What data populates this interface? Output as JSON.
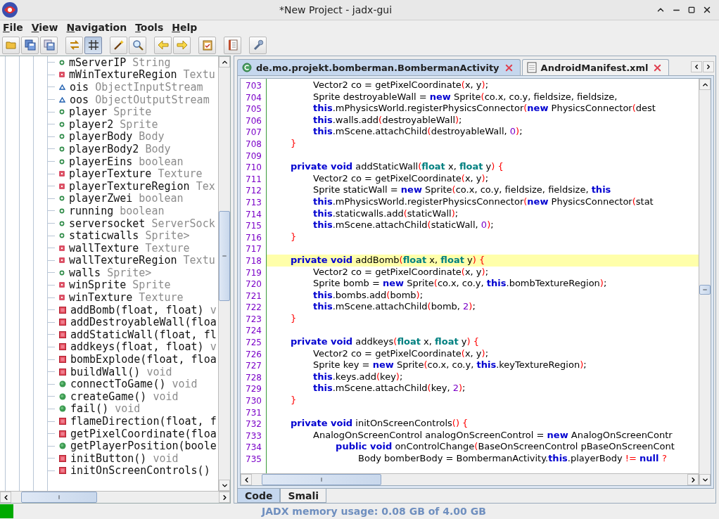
{
  "window": {
    "title": "*New Project - jadx-gui"
  },
  "menu": [
    {
      "label": "File"
    },
    {
      "label": "View"
    },
    {
      "label": "Navigation"
    },
    {
      "label": "Tools"
    },
    {
      "label": "Help"
    }
  ],
  "toolbar": [
    {
      "kind": "open",
      "pressed": false
    },
    {
      "kind": "save-all",
      "pressed": false
    },
    {
      "kind": "export",
      "pressed": false
    },
    {
      "kind": "sync",
      "pressed": false
    },
    {
      "kind": "flatten",
      "pressed": true
    },
    {
      "kind": "wand",
      "pressed": false
    },
    {
      "kind": "search",
      "pressed": false
    },
    {
      "kind": "back",
      "pressed": false
    },
    {
      "kind": "forward",
      "pressed": false
    },
    {
      "kind": "clipboard",
      "pressed": false
    },
    {
      "kind": "log",
      "pressed": false
    },
    {
      "kind": "settings",
      "pressed": false
    }
  ],
  "tree": {
    "items": [
      {
        "kind": "field-public",
        "name": "mServerIP",
        "type": "String"
      },
      {
        "kind": "field-private",
        "name": "mWinTextureRegion",
        "type": "Textu"
      },
      {
        "kind": "field-package",
        "name": "ois",
        "type": "ObjectInputStream"
      },
      {
        "kind": "field-package",
        "name": "oos",
        "type": "ObjectOutputStream"
      },
      {
        "kind": "field-public",
        "name": "player",
        "type": "Sprite"
      },
      {
        "kind": "field-public",
        "name": "player2",
        "type": "Sprite"
      },
      {
        "kind": "field-public",
        "name": "playerBody",
        "type": "Body"
      },
      {
        "kind": "field-public",
        "name": "playerBody2",
        "type": "Body"
      },
      {
        "kind": "field-public",
        "name": "playerEins",
        "type": "boolean"
      },
      {
        "kind": "field-private",
        "name": "playerTexture",
        "type": "Texture"
      },
      {
        "kind": "field-private",
        "name": "playerTextureRegion",
        "type": "Tex"
      },
      {
        "kind": "field-public",
        "name": "playerZwei",
        "type": "boolean"
      },
      {
        "kind": "field-public",
        "name": "running",
        "type": "boolean"
      },
      {
        "kind": "field-public",
        "name": "serversocket",
        "type": "ServerSock"
      },
      {
        "kind": "field-public",
        "name": "staticwalls",
        "type": "Sprite>"
      },
      {
        "kind": "field-private",
        "name": "wallTexture",
        "type": "Texture"
      },
      {
        "kind": "field-private",
        "name": "wallTextureRegion",
        "type": "Textu"
      },
      {
        "kind": "field-public",
        "name": "walls",
        "type": "Sprite>"
      },
      {
        "kind": "field-private",
        "name": "winSprite",
        "type": "Sprite"
      },
      {
        "kind": "field-private",
        "name": "winTexture",
        "type": "Texture"
      },
      {
        "kind": "method-private",
        "name": "addBomb(float, float)",
        "type": "v"
      },
      {
        "kind": "method-private",
        "name": "addDestroyableWall(floa"
      },
      {
        "kind": "method-private",
        "name": "addStaticWall(float, fl"
      },
      {
        "kind": "method-private",
        "name": "addkeys(float, float)",
        "type": "v"
      },
      {
        "kind": "method-private",
        "name": "bombExplode(float, floa"
      },
      {
        "kind": "method-private",
        "name": "buildWall()",
        "type": "void"
      },
      {
        "kind": "method-public",
        "name": "connectToGame()",
        "type": "void"
      },
      {
        "kind": "method-public",
        "name": "createGame()",
        "type": "void"
      },
      {
        "kind": "method-public",
        "name": "fail()",
        "type": "void"
      },
      {
        "kind": "method-private",
        "name": "flameDirection(float, f"
      },
      {
        "kind": "method-private",
        "name": "getPixelCoordinate(floa"
      },
      {
        "kind": "method-public",
        "name": "getPlayerPosition(boole"
      },
      {
        "kind": "method-private",
        "name": "initButton()",
        "type": "void"
      },
      {
        "kind": "method-private",
        "name": "initOnScreenControls()"
      }
    ]
  },
  "editor_tabs": [
    {
      "kind": "class",
      "label": "de.mo.projekt.bomberman.BombermanActivity",
      "selected": true
    },
    {
      "kind": "xml",
      "label": "AndroidManifest.xml",
      "selected": false
    }
  ],
  "code": {
    "lines": [
      {
        "number": "703",
        "highlighted": false,
        "code": [
          {
            "kind": "plain",
            "text": "        Vector2 co = getPixelCoordinate"
          },
          {
            "kind": "bracket",
            "text": "("
          },
          {
            "kind": "plain",
            "text": "x, y"
          },
          {
            "kind": "bracket",
            "text": ")"
          },
          {
            "kind": "plain",
            "text": ";"
          }
        ]
      },
      {
        "number": "704",
        "highlighted": false,
        "code": [
          {
            "kind": "plain",
            "text": "        Sprite destroyableWall = "
          },
          {
            "kind": "keyword",
            "text": "new"
          },
          {
            "kind": "plain",
            "text": " Sprite"
          },
          {
            "kind": "bracket",
            "text": "("
          },
          {
            "kind": "plain",
            "text": "co.x, co.y, fieldsize, fieldsize,"
          }
        ]
      },
      {
        "number": "705",
        "highlighted": false,
        "code": [
          {
            "kind": "keyword",
            "text": "        this"
          },
          {
            "kind": "plain",
            "text": ".mPhysicsWorld.registerPhysicsConnector"
          },
          {
            "kind": "bracket",
            "text": "("
          },
          {
            "kind": "keyword",
            "text": "new"
          },
          {
            "kind": "plain",
            "text": " PhysicsConnector"
          },
          {
            "kind": "bracket",
            "text": "("
          },
          {
            "kind": "plain",
            "text": "dest"
          }
        ]
      },
      {
        "number": "706",
        "highlighted": false,
        "code": [
          {
            "kind": "keyword",
            "text": "        this"
          },
          {
            "kind": "plain",
            "text": ".walls.add"
          },
          {
            "kind": "bracket",
            "text": "("
          },
          {
            "kind": "plain",
            "text": "destroyableWall"
          },
          {
            "kind": "bracket",
            "text": ")"
          },
          {
            "kind": "plain",
            "text": ";"
          }
        ]
      },
      {
        "number": "707",
        "highlighted": false,
        "code": [
          {
            "kind": "keyword",
            "text": "        this"
          },
          {
            "kind": "plain",
            "text": ".mScene.attachChild"
          },
          {
            "kind": "bracket",
            "text": "("
          },
          {
            "kind": "plain",
            "text": "destroyableWall, "
          },
          {
            "kind": "number",
            "text": "0"
          },
          {
            "kind": "bracket",
            "text": ")"
          },
          {
            "kind": "plain",
            "text": ";"
          }
        ]
      },
      {
        "number": "708",
        "highlighted": false,
        "code": [
          {
            "kind": "bracket",
            "text": "    }"
          }
        ]
      },
      {
        "number": "709",
        "highlighted": false
      },
      {
        "number": "710",
        "highlighted": false,
        "code": [
          {
            "kind": "keyword",
            "text": "    private void"
          },
          {
            "kind": "plain",
            "text": " addStaticWall"
          },
          {
            "kind": "bracket",
            "text": "("
          },
          {
            "kind": "type",
            "text": "float"
          },
          {
            "kind": "plain",
            "text": " x, "
          },
          {
            "kind": "type",
            "text": "float"
          },
          {
            "kind": "plain",
            "text": " y"
          },
          {
            "kind": "bracket",
            "text": ") {"
          }
        ]
      },
      {
        "number": "711",
        "highlighted": false,
        "code": [
          {
            "kind": "plain",
            "text": "        Vector2 co = getPixelCoordinate"
          },
          {
            "kind": "bracket",
            "text": "("
          },
          {
            "kind": "plain",
            "text": "x, y"
          },
          {
            "kind": "bracket",
            "text": ")"
          },
          {
            "kind": "plain",
            "text": ";"
          }
        ]
      },
      {
        "number": "712",
        "highlighted": false,
        "code": [
          {
            "kind": "plain",
            "text": "        Sprite staticWall = "
          },
          {
            "kind": "keyword",
            "text": "new"
          },
          {
            "kind": "plain",
            "text": " Sprite"
          },
          {
            "kind": "bracket",
            "text": "("
          },
          {
            "kind": "plain",
            "text": "co.x, co.y, fieldsize, fieldsize, "
          },
          {
            "kind": "keyword",
            "text": "this"
          }
        ]
      },
      {
        "number": "713",
        "highlighted": false,
        "code": [
          {
            "kind": "keyword",
            "text": "        this"
          },
          {
            "kind": "plain",
            "text": ".mPhysicsWorld.registerPhysicsConnector"
          },
          {
            "kind": "bracket",
            "text": "("
          },
          {
            "kind": "keyword",
            "text": "new"
          },
          {
            "kind": "plain",
            "text": " PhysicsConnector"
          },
          {
            "kind": "bracket",
            "text": "("
          },
          {
            "kind": "plain",
            "text": "stat"
          }
        ]
      },
      {
        "number": "714",
        "highlighted": false,
        "code": [
          {
            "kind": "keyword",
            "text": "        this"
          },
          {
            "kind": "plain",
            "text": ".staticwalls.add"
          },
          {
            "kind": "bracket",
            "text": "("
          },
          {
            "kind": "plain",
            "text": "staticWall"
          },
          {
            "kind": "bracket",
            "text": ")"
          },
          {
            "kind": "plain",
            "text": ";"
          }
        ]
      },
      {
        "number": "715",
        "highlighted": false,
        "code": [
          {
            "kind": "keyword",
            "text": "        this"
          },
          {
            "kind": "plain",
            "text": ".mScene.attachChild"
          },
          {
            "kind": "bracket",
            "text": "("
          },
          {
            "kind": "plain",
            "text": "staticWall, "
          },
          {
            "kind": "number",
            "text": "0"
          },
          {
            "kind": "bracket",
            "text": ")"
          },
          {
            "kind": "plain",
            "text": ";"
          }
        ]
      },
      {
        "number": "716",
        "highlighted": false,
        "code": [
          {
            "kind": "bracket",
            "text": "    }"
          }
        ]
      },
      {
        "number": "717",
        "highlighted": false
      },
      {
        "number": "718",
        "highlighted": true,
        "code": [
          {
            "kind": "keyword",
            "text": "    private void"
          },
          {
            "kind": "plain",
            "text": " addBomb"
          },
          {
            "kind": "bracket",
            "text": "("
          },
          {
            "kind": "type",
            "text": "float"
          },
          {
            "kind": "plain",
            "text": " x, "
          },
          {
            "kind": "type",
            "text": "float"
          },
          {
            "kind": "plain",
            "text": " y"
          },
          {
            "kind": "bracket",
            "text": ") {"
          }
        ]
      },
      {
        "number": "719",
        "highlighted": false,
        "code": [
          {
            "kind": "plain",
            "text": "        Vector2 co = getPixelCoordinate"
          },
          {
            "kind": "bracket",
            "text": "("
          },
          {
            "kind": "plain",
            "text": "x, y"
          },
          {
            "kind": "bracket",
            "text": ")"
          },
          {
            "kind": "plain",
            "text": ";"
          }
        ]
      },
      {
        "number": "720",
        "highlighted": false,
        "code": [
          {
            "kind": "plain",
            "text": "        Sprite bomb = "
          },
          {
            "kind": "keyword",
            "text": "new"
          },
          {
            "kind": "plain",
            "text": " Sprite"
          },
          {
            "kind": "bracket",
            "text": "("
          },
          {
            "kind": "plain",
            "text": "co.x, co.y, "
          },
          {
            "kind": "keyword",
            "text": "this"
          },
          {
            "kind": "plain",
            "text": ".bombTextureRegion"
          },
          {
            "kind": "bracket",
            "text": ")"
          },
          {
            "kind": "plain",
            "text": ";"
          }
        ]
      },
      {
        "number": "721",
        "highlighted": false,
        "code": [
          {
            "kind": "keyword",
            "text": "        this"
          },
          {
            "kind": "plain",
            "text": ".bombs.add"
          },
          {
            "kind": "bracket",
            "text": "("
          },
          {
            "kind": "plain",
            "text": "bomb"
          },
          {
            "kind": "bracket",
            "text": ")"
          },
          {
            "kind": "plain",
            "text": ";"
          }
        ]
      },
      {
        "number": "722",
        "highlighted": false,
        "code": [
          {
            "kind": "keyword",
            "text": "        this"
          },
          {
            "kind": "plain",
            "text": ".mScene.attachChild"
          },
          {
            "kind": "bracket",
            "text": "("
          },
          {
            "kind": "plain",
            "text": "bomb, "
          },
          {
            "kind": "number",
            "text": "2"
          },
          {
            "kind": "bracket",
            "text": ")"
          },
          {
            "kind": "plain",
            "text": ";"
          }
        ]
      },
      {
        "number": "723",
        "highlighted": false,
        "code": [
          {
            "kind": "bracket",
            "text": "    }"
          }
        ]
      },
      {
        "number": "724",
        "highlighted": false
      },
      {
        "number": "725",
        "highlighted": false,
        "code": [
          {
            "kind": "keyword",
            "text": "    private void"
          },
          {
            "kind": "plain",
            "text": " addkeys"
          },
          {
            "kind": "bracket",
            "text": "("
          },
          {
            "kind": "type",
            "text": "float"
          },
          {
            "kind": "plain",
            "text": " x, "
          },
          {
            "kind": "type",
            "text": "float"
          },
          {
            "kind": "plain",
            "text": " y"
          },
          {
            "kind": "bracket",
            "text": ") {"
          }
        ]
      },
      {
        "number": "726",
        "highlighted": false,
        "code": [
          {
            "kind": "plain",
            "text": "        Vector2 co = getPixelCoordinate"
          },
          {
            "kind": "bracket",
            "text": "("
          },
          {
            "kind": "plain",
            "text": "x, y"
          },
          {
            "kind": "bracket",
            "text": ")"
          },
          {
            "kind": "plain",
            "text": ";"
          }
        ]
      },
      {
        "number": "727",
        "highlighted": false,
        "code": [
          {
            "kind": "plain",
            "text": "        Sprite key = "
          },
          {
            "kind": "keyword",
            "text": "new"
          },
          {
            "kind": "plain",
            "text": " Sprite"
          },
          {
            "kind": "bracket",
            "text": "("
          },
          {
            "kind": "plain",
            "text": "co.x, co.y, "
          },
          {
            "kind": "keyword",
            "text": "this"
          },
          {
            "kind": "plain",
            "text": ".keyTextureRegion"
          },
          {
            "kind": "bracket",
            "text": ")"
          },
          {
            "kind": "plain",
            "text": ";"
          }
        ]
      },
      {
        "number": "728",
        "highlighted": false,
        "code": [
          {
            "kind": "keyword",
            "text": "        this"
          },
          {
            "kind": "plain",
            "text": ".keys.add"
          },
          {
            "kind": "bracket",
            "text": "("
          },
          {
            "kind": "plain",
            "text": "key"
          },
          {
            "kind": "bracket",
            "text": ")"
          },
          {
            "kind": "plain",
            "text": ";"
          }
        ]
      },
      {
        "number": "729",
        "highlighted": false,
        "code": [
          {
            "kind": "keyword",
            "text": "        this"
          },
          {
            "kind": "plain",
            "text": ".mScene.attachChild"
          },
          {
            "kind": "bracket",
            "text": "("
          },
          {
            "kind": "plain",
            "text": "key, "
          },
          {
            "kind": "number",
            "text": "2"
          },
          {
            "kind": "bracket",
            "text": ")"
          },
          {
            "kind": "plain",
            "text": ";"
          }
        ]
      },
      {
        "number": "730",
        "highlighted": false,
        "code": [
          {
            "kind": "bracket",
            "text": "    }"
          }
        ]
      },
      {
        "number": "731",
        "highlighted": false
      },
      {
        "number": "732",
        "highlighted": false,
        "code": [
          {
            "kind": "keyword",
            "text": "    private void"
          },
          {
            "kind": "plain",
            "text": " initOnScreenControls"
          },
          {
            "kind": "bracket",
            "text": "() {"
          }
        ]
      },
      {
        "number": "733",
        "highlighted": false,
        "code": [
          {
            "kind": "plain",
            "text": "        AnalogOnScreenControl analogOnScreenControl = "
          },
          {
            "kind": "keyword",
            "text": "new"
          },
          {
            "kind": "plain",
            "text": " AnalogOnScreenContr"
          }
        ]
      },
      {
        "number": "734",
        "highlighted": false,
        "code": [
          {
            "kind": "keyword",
            "text": "            public void"
          },
          {
            "kind": "plain",
            "text": " onControlChange"
          },
          {
            "kind": "bracket",
            "text": "("
          },
          {
            "kind": "plain",
            "text": "BaseOnScreenControl pBaseOnScreenCont"
          }
        ]
      },
      {
        "number": "735",
        "highlighted": false,
        "code": [
          {
            "kind": "plain",
            "text": "                Body bomberBody = BombermanActivity."
          },
          {
            "kind": "keyword",
            "text": "this"
          },
          {
            "kind": "plain",
            "text": ".playerBody "
          },
          {
            "kind": "bracket",
            "text": "!= "
          },
          {
            "kind": "keyword",
            "text": "null "
          },
          {
            "kind": "bracket",
            "text": "?"
          }
        ]
      }
    ]
  },
  "view_tabs": [
    {
      "label": "Code",
      "selected": true
    },
    {
      "label": "Smali",
      "selected": false
    }
  ],
  "status_bar": {
    "memory": "JADX memory usage: 0.08 GB of 4.00 GB"
  }
}
